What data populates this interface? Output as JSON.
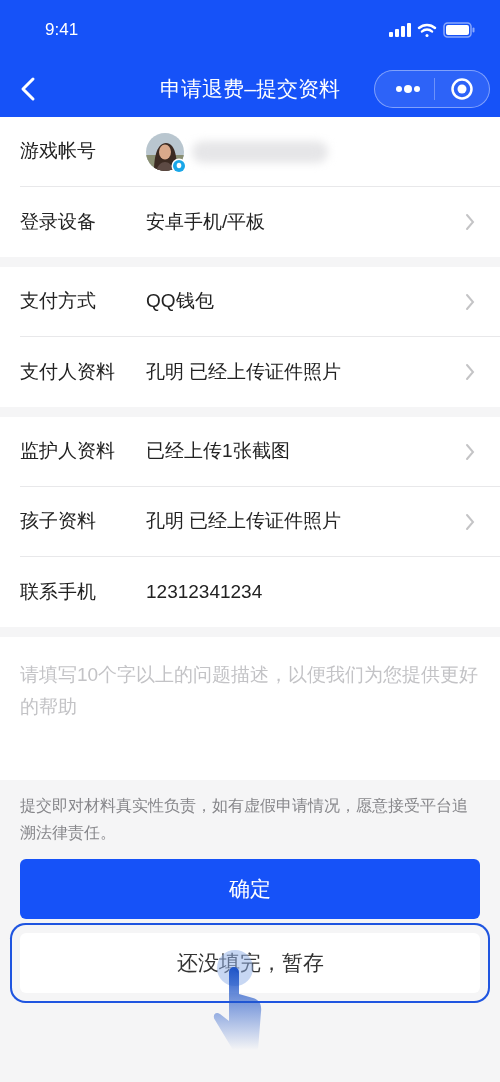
{
  "status_bar": {
    "time": "9:41"
  },
  "nav": {
    "title": "申请退费–提交资料"
  },
  "groups": [
    {
      "rows": [
        {
          "kind": "account",
          "label": "游戏帐号",
          "arrow": false
        },
        {
          "kind": "text",
          "label": "登录设备",
          "value": "安卓手机/平板",
          "arrow": true
        }
      ]
    },
    {
      "rows": [
        {
          "kind": "text",
          "label": "支付方式",
          "value": "QQ钱包",
          "arrow": true
        },
        {
          "kind": "text",
          "label": "支付人资料",
          "value": "孔明 已经上传证件照片",
          "arrow": true
        }
      ]
    },
    {
      "rows": [
        {
          "kind": "text",
          "label": "监护人资料",
          "value": "已经上传1张截图",
          "arrow": true
        },
        {
          "kind": "text",
          "label": "孩子资料",
          "value": "孔明 已经上传证件照片",
          "arrow": true
        },
        {
          "kind": "text",
          "label": "联系手机",
          "value": "12312341234",
          "arrow": false
        }
      ]
    }
  ],
  "description": {
    "placeholder": "请填写10个字以上的问题描述，以便我们为您提供更好的帮助"
  },
  "notice": "提交即对材料真实性负责，如有虚假申请情况，愿意接受平台追溯法律责任。",
  "buttons": [
    {
      "kind": "primary",
      "label": "确定",
      "highlighted": false
    },
    {
      "kind": "secondary",
      "label": "还没填完，暂存",
      "highlighted": true
    }
  ]
}
